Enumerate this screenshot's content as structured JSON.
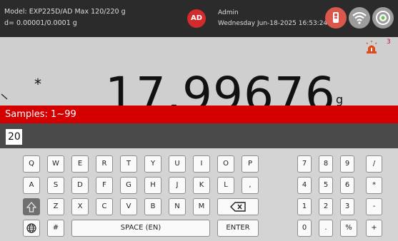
{
  "status_bar": {
    "model_line": "Model: EXP225D/AD   Max 120/220 g",
    "resolution_line": "d= 0.00001/0.0001 g",
    "avatar_initials": "AD",
    "user_name": "Admin",
    "datetime": "Wednesday Jun-18-2025 16:53:24",
    "icons": [
      "usb-icon",
      "wifi-icon",
      "target-icon"
    ],
    "avatar_color": "#d32b2b"
  },
  "display": {
    "stability_marker": "*",
    "weight": "17.99676",
    "unit": "g",
    "alarm_count": "3",
    "alarm_icon": "siren-icon"
  },
  "banner": {
    "text": "Samples: 1~99",
    "color": "#d40000"
  },
  "input": {
    "value": "20"
  },
  "keyboard": {
    "row1": [
      "Q",
      "W",
      "E",
      "R",
      "T",
      "Y",
      "U",
      "I",
      "O",
      "P"
    ],
    "row2": [
      "A",
      "S",
      "D",
      "F",
      "G",
      "H",
      "J",
      "K",
      "L",
      ","
    ],
    "row3": [
      "Z",
      "X",
      "C",
      "V",
      "B",
      "N",
      "M"
    ],
    "hash": "#",
    "space": "SPACE (EN)",
    "enter": "ENTER",
    "numpad": [
      [
        "7",
        "8",
        "9",
        "/"
      ],
      [
        "4",
        "5",
        "6",
        "*"
      ],
      [
        "1",
        "2",
        "3",
        "-"
      ],
      [
        "0",
        ".",
        "%",
        "+"
      ]
    ],
    "icons": [
      "shift-icon",
      "backspace-icon",
      "globe-icon"
    ]
  }
}
